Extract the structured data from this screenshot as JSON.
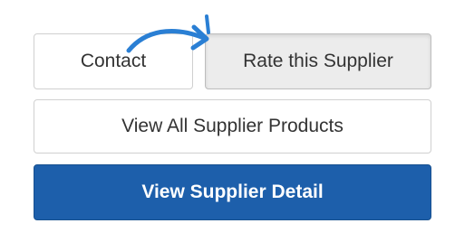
{
  "buttons": {
    "contact": "Contact",
    "rate": "Rate this Supplier",
    "view_products": "View All Supplier Products",
    "view_detail": "View Supplier Detail"
  },
  "icons": {
    "arrow": "curved-arrow-icon"
  },
  "colors": {
    "primary_blue": "#1d5fab",
    "annotation_arrow": "#2a7fd4",
    "active_gray": "#ececec"
  }
}
